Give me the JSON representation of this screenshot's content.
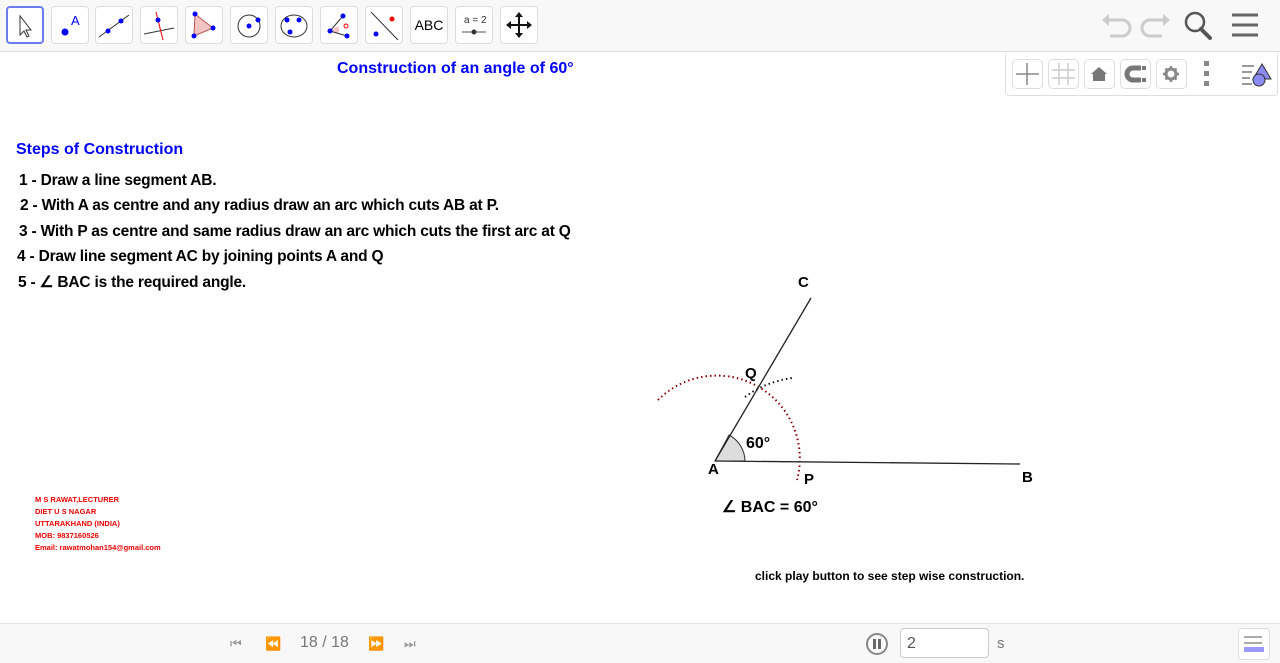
{
  "toolbar": {
    "tools": [
      "move",
      "point",
      "line",
      "perpendicular-line",
      "polygon",
      "circle-center-point",
      "circle-three-points",
      "angle",
      "reflect",
      "text",
      "slider",
      "move-graphics-view"
    ],
    "text_tool_label": "ABC",
    "slider_label": "a = 2",
    "text_point_label": "A"
  },
  "graphics_panel": {
    "buttons": [
      "axes",
      "grid",
      "home",
      "snap",
      "settings",
      "more",
      "style-bar"
    ]
  },
  "title": "Construction of an angle of 60°",
  "steps": {
    "heading": "Steps of Construction",
    "items": [
      "1 - Draw a line segment AB.",
      "2 - With A as centre and any radius draw an arc which cuts AB at P.",
      "3 - With P as centre and same  radius draw an arc which cuts the first arc at Q",
      "4 - Draw line segment AC by joining points A and Q",
      "5 - ∠ BAC is the required angle."
    ]
  },
  "author": [
    "M S RAWAT,LECTURER",
    "DIET U S NAGAR",
    "UTTARAKHAND (INDIA)",
    "MOB: 9837160526",
    "Email: rawatmohan154@gmail.com"
  ],
  "construction": {
    "labels": {
      "A": "A",
      "B": "B",
      "C": "C",
      "P": "P",
      "Q": "Q"
    },
    "angle_label": "60°",
    "angle_text": "∠ BAC = 60°",
    "arc_color": "#8b0000"
  },
  "hint": "click play button to see step wise construction.",
  "player": {
    "page": "18 / 18",
    "speed": "2",
    "unit": "s"
  },
  "colors": {
    "accent": "#0000ff",
    "author": "#ee0000"
  }
}
